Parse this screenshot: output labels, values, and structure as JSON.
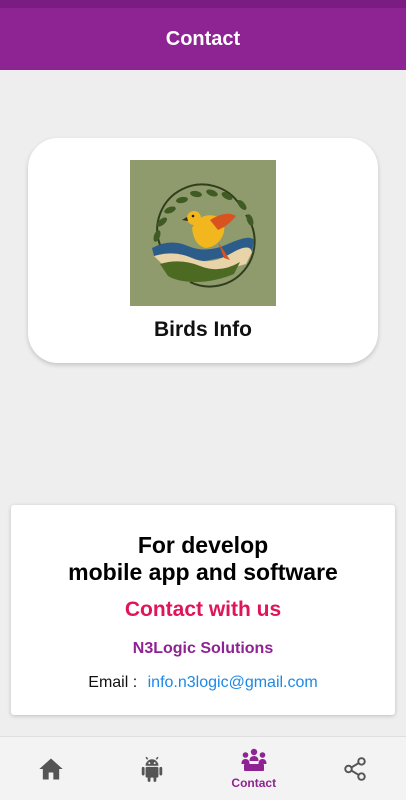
{
  "app_bar": {
    "title": "Contact"
  },
  "app_card": {
    "logo_icon": "bird-logo-icon",
    "name": "Birds Info"
  },
  "contact_card": {
    "headline_line1": "For develop",
    "headline_line2": "mobile app and software",
    "cta": "Contact with us",
    "company": "N3Logic Solutions",
    "email_label": "Email :",
    "email_value": "info.n3logic@gmail.com"
  },
  "bottom_nav": {
    "items": [
      {
        "icon": "home-icon",
        "label": ""
      },
      {
        "icon": "android-icon",
        "label": ""
      },
      {
        "icon": "contact-group-icon",
        "label": "Contact",
        "active": true
      },
      {
        "icon": "share-icon",
        "label": ""
      }
    ]
  },
  "colors": {
    "primary": "#8e2393",
    "accent_pink": "#e0145a",
    "link_blue": "#1e88e5",
    "icon_gray": "#555555"
  }
}
